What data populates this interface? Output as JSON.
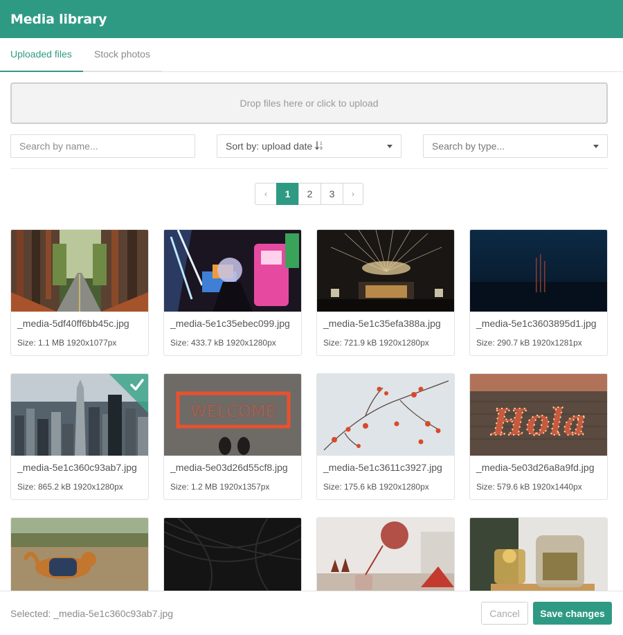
{
  "app": {
    "title": "Media library"
  },
  "tabs": [
    {
      "label": "Uploaded files",
      "active": true
    },
    {
      "label": "Stock photos",
      "active": false
    }
  ],
  "dropzone": {
    "text": "Drop files here or click to upload"
  },
  "filters": {
    "search_placeholder": "Search by name...",
    "sort_label": "Sort by: upload date",
    "sort_icon": "sort-numeric-asc-icon",
    "type_placeholder": "Search by type..."
  },
  "pagination": {
    "prev": "‹",
    "next": "›",
    "pages": [
      "1",
      "2",
      "3"
    ],
    "current": "1"
  },
  "media": [
    {
      "name": "_media-5df40ff6bb45c.jpg",
      "meta": "Size: 1.1 MB 1920x1077px",
      "subject": "forest road"
    },
    {
      "name": "_media-5e1c35ebec099.jpg",
      "meta": "Size: 433.7 kB 1920x1280px",
      "subject": "neon arcade with crystal ball"
    },
    {
      "name": "_media-5e1c35efa388a.jpg",
      "meta": "Size: 721.9 kB 1920x1280px",
      "subject": "fireworks over concert stage"
    },
    {
      "name": "_media-5e1c3603895d1.jpg",
      "meta": "Size: 290.7 kB 1920x1281px",
      "subject": "dark blue blurred night"
    },
    {
      "name": "_media-5e1c360c93ab7.jpg",
      "meta": "Size: 865.2 kB 1920x1280px",
      "subject": "city skyline",
      "selected": true
    },
    {
      "name": "_media-5e03d26d55cf8.jpg",
      "meta": "Size: 1.2 MB 1920x1357px",
      "subject": "welcome doormat",
      "overlay_text": "WELCOME"
    },
    {
      "name": "_media-5e1c3611c3927.jpg",
      "meta": "Size: 175.6 kB 1920x1280px",
      "subject": "red berries on branch"
    },
    {
      "name": "_media-5e03d26a8a9fd.jpg",
      "meta": "Size: 579.6 kB 1920x1440px",
      "subject": "marquee lights sign",
      "overlay_text": "Hola"
    },
    {
      "name": "",
      "meta": "",
      "subject": "dog in field"
    },
    {
      "name": "",
      "meta": "",
      "subject": "dark hair texture"
    },
    {
      "name": "",
      "meta": "",
      "subject": "tea being poured"
    },
    {
      "name": "",
      "meta": "",
      "subject": "teapot with herbal tea"
    }
  ],
  "footer": {
    "selected_text": "Selected: _media-5e1c360c93ab7.jpg",
    "cancel_label": "Cancel",
    "save_label": "Save changes"
  },
  "colors": {
    "accent": "#2f9a83"
  }
}
